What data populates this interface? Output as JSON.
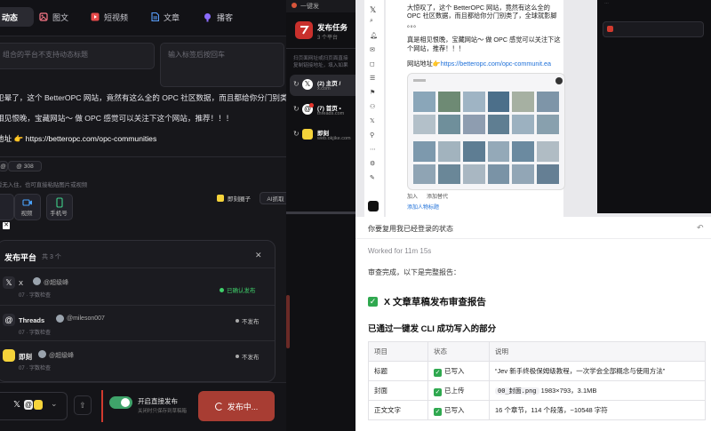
{
  "editor": {
    "tabs": [
      {
        "label": "动态",
        "active": true
      },
      {
        "label": "图文"
      },
      {
        "label": "短视频"
      },
      {
        "label": "文章"
      },
      {
        "label": "播客"
      }
    ],
    "title_placeholder": "组合的平台不支持动态标题",
    "tags_placeholder": "输入标签后按回车",
    "body_lines": [
      "犯晕了，这个 BetterOPC 网站，竟然有这么全的 OPC 社区数据，而且都给你分门别类了，全球",
      "相见恨晚，宝藏网站～ 做 OPC 感觉可以关注下这个网站，推荐！！！",
      "地址 👉 https://betteropc.com/opc-communities"
    ],
    "char_count": "308",
    "media_hint": "暂无入住，也可直接粘贴图片或视频",
    "media_buttons": [
      "视频",
      "手机号"
    ],
    "jike_label": "即刻圈子",
    "ai_label": "AI抓取"
  },
  "platforms": {
    "title": "发布平台",
    "count_label": "共 3 个",
    "items": [
      {
        "name": "X",
        "account": "@超级峰",
        "status": "已确认发布",
        "meta": "07 · 字数检查"
      },
      {
        "name": "Threads",
        "account": "@mileson007",
        "status": "不发布",
        "meta": "07 · 字数检查"
      },
      {
        "name": "即刻",
        "account": "@超级峰",
        "status": "不发布",
        "meta": "07 · 字数检查"
      }
    ]
  },
  "bottom_bar": {
    "toggle_label": "开启直接发布",
    "toggle_sub": "关闭时只保存到草稿箱",
    "publish_label": "发布中..."
  },
  "middle": {
    "top_title": "一键发",
    "header_title": "发布任务",
    "header_sub": "3 个平台",
    "notice": "扫页面网址或扫页面直接复制链接地址，填入如果错误请在此处",
    "tasks": [
      {
        "label": "(2) 主页 /",
        "sub": "x.com",
        "icon": "x"
      },
      {
        "label": "(7) 首页 •",
        "sub": "threads.com",
        "icon": "threads"
      },
      {
        "label": "即刻",
        "sub": "web.okjike.com",
        "icon": "jike"
      }
    ]
  },
  "browser_post": {
    "text1": "大惊叹了，这个 BetterOPC 网站，竟然有这么全的 OPC 社区数据，而且都给你分门别类了，全球就影脚",
    "dots": "。。。",
    "text2": "真是相见恨晚，宝藏网站～ 做 OPC 感觉可以关注下这个网站，推荐！！！",
    "addr_label": "网站地址👉",
    "addr_url": "https://betteropc.com/opc-communit.ea",
    "post_label": "图片",
    "action1": "加入",
    "action2": "添加替代",
    "footer_link": "添加人物标题"
  },
  "report": {
    "prompt": "你要复用我已经登录的状态",
    "worked": "Worked for 11m 15s",
    "done": "审查完成，以下是完整报告：",
    "heading": "X 文章草稿发布审查报告",
    "subheading": "已通过一键发 CLI 成功写入的部分",
    "columns": [
      "项目",
      "状态",
      "说明"
    ],
    "rows": [
      {
        "item": "标题",
        "status": "已写入",
        "note": "“Jev 新手终极保姆级教程，一次学会全部概念与使用方法”"
      },
      {
        "item": "封面",
        "status": "已上传",
        "file": "00_封面.png",
        "note": "1983×793，3.1MB"
      },
      {
        "item": "正文文字",
        "status": "已写入",
        "note": "16 个章节，114 个段落，~10548 字符"
      }
    ]
  },
  "colors": {
    "accent_red": "#c0392b",
    "check_green": "#2fa84f",
    "jike_yellow": "#f5d33a"
  }
}
